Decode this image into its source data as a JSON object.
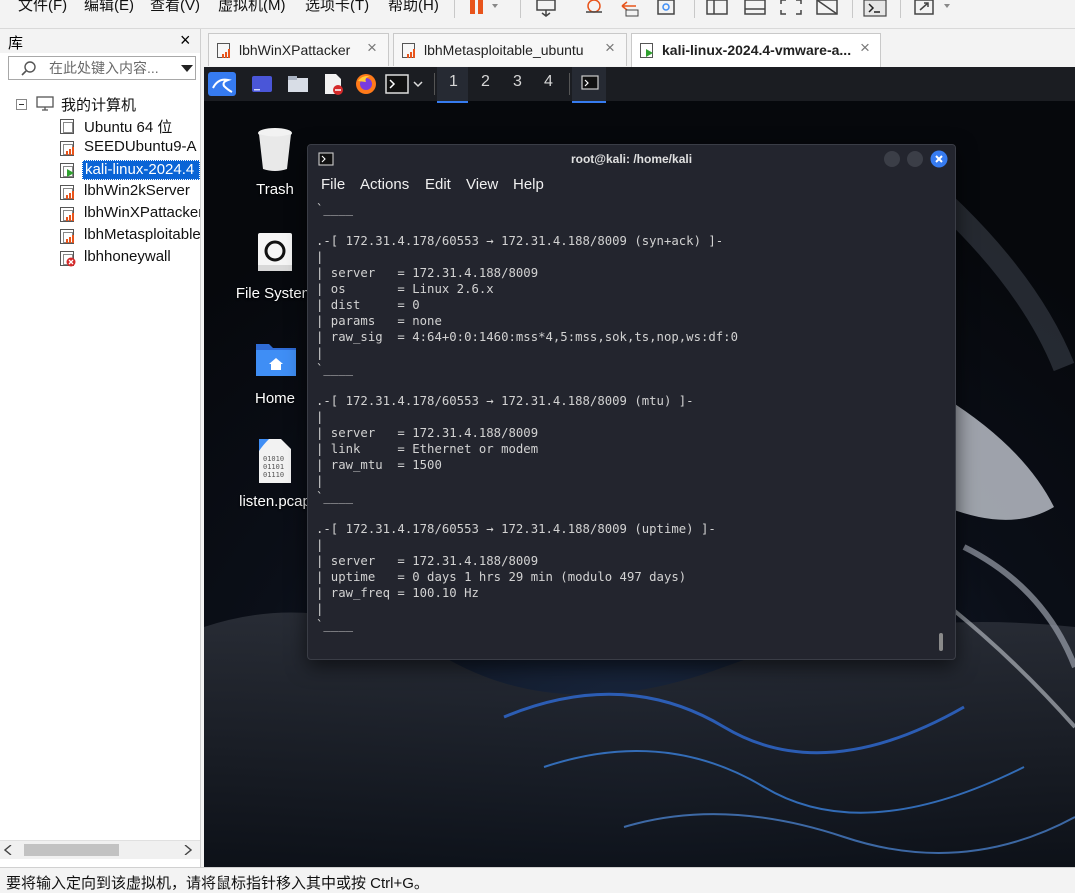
{
  "menubar": {
    "items": [
      "文件(F)",
      "编辑(E)",
      "查看(V)",
      "虚拟机(M)",
      "选项卡(T)",
      "帮助(H)"
    ]
  },
  "library": {
    "title": "库",
    "close": "×",
    "search_placeholder": "在此处键入内容...",
    "root_label": "我的计算机",
    "vms": [
      {
        "label": "Ubuntu 64 位",
        "state": "off"
      },
      {
        "label": "SEEDUbuntu9-A",
        "state": "bars"
      },
      {
        "label": "kali-linux-2024.4",
        "state": "running",
        "selected": true
      },
      {
        "label": "lbhWin2kServer",
        "state": "bars"
      },
      {
        "label": "lbhWinXPattacker",
        "state": "bars"
      },
      {
        "label": "lbhMetasploitable",
        "state": "bars"
      },
      {
        "label": "lbhhoneywall",
        "state": "error"
      }
    ]
  },
  "tabs": [
    {
      "label": "lbhWinXPattacker",
      "close": "×"
    },
    {
      "label": "lbhMetasploitable_ubuntu",
      "close": "×"
    },
    {
      "label": "kali-linux-2024.4-vmware-a...",
      "close": "×",
      "active": true
    }
  ],
  "kali_panel": {
    "workspaces": [
      "1",
      "2",
      "3",
      "4"
    ],
    "active_workspace": "1"
  },
  "desktop": {
    "icons": [
      {
        "label": "Trash",
        "icon": "trash-icon"
      },
      {
        "label": "File System",
        "icon": "drive-icon"
      },
      {
        "label": "Home",
        "icon": "home-folder-icon"
      },
      {
        "label": "listen.pcap",
        "icon": "binary-file-icon"
      }
    ]
  },
  "terminal": {
    "title": "root@kali: /home/kali",
    "menu": [
      "File",
      "Actions",
      "Edit",
      "View",
      "Help"
    ],
    "lines": [
      "`____",
      "",
      ".-[ 172.31.4.178/60553 → 172.31.4.188/8009 (syn+ack) ]-",
      "|",
      "| server   = 172.31.4.188/8009",
      "| os       = Linux 2.6.x",
      "| dist     = 0",
      "| params   = none",
      "| raw_sig  = 4:64+0:0:1460:mss*4,5:mss,sok,ts,nop,ws:df:0",
      "|",
      "`____",
      "",
      ".-[ 172.31.4.178/60553 → 172.31.4.188/8009 (mtu) ]-",
      "|",
      "| server   = 172.31.4.188/8009",
      "| link     = Ethernet or modem",
      "| raw_mtu  = 1500",
      "|",
      "`____",
      "",
      ".-[ 172.31.4.178/60553 → 172.31.4.188/8009 (uptime) ]-",
      "|",
      "| server   = 172.31.4.188/8009",
      "| uptime   = 0 days 1 hrs 29 min (modulo 497 days)",
      "| raw_freq = 100.10 Hz",
      "|",
      "`____"
    ]
  },
  "status": {
    "text": "要将输入定向到该虚拟机，请将鼠标指针移入其中或按 Ctrl+G。"
  },
  "colors": {
    "accent_blue": "#3f8ef5",
    "vm_bars": "#e8541b",
    "running_green": "#2fa12f",
    "error_red": "#d42a2a",
    "kali_blue": "#367bf0"
  }
}
